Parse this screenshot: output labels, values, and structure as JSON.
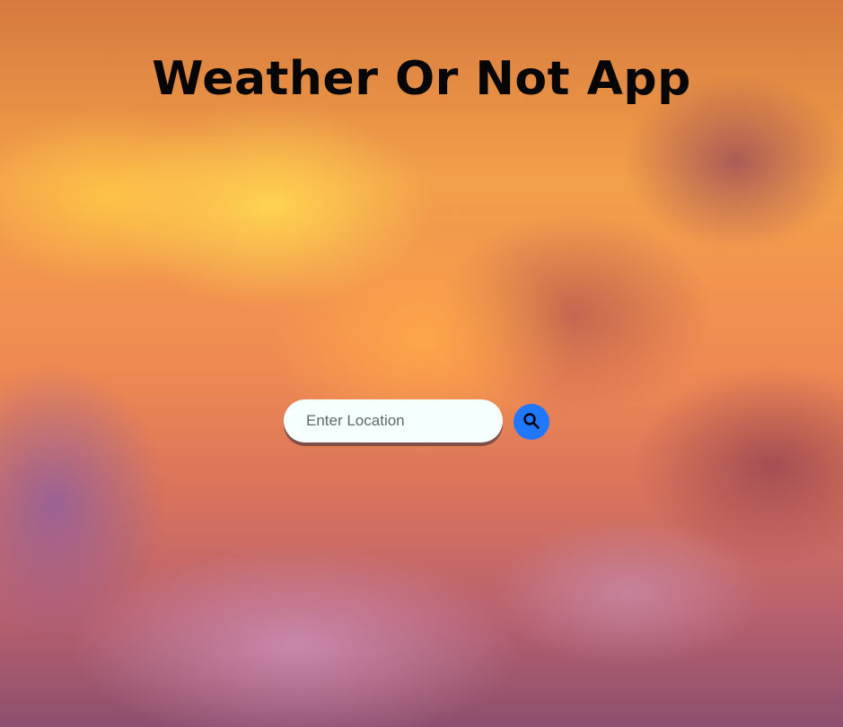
{
  "header": {
    "title": "Weather Or Not App"
  },
  "search": {
    "placeholder": "Enter Location",
    "value": "",
    "button_icon": "search-icon",
    "button_color": "#1f78ff"
  }
}
